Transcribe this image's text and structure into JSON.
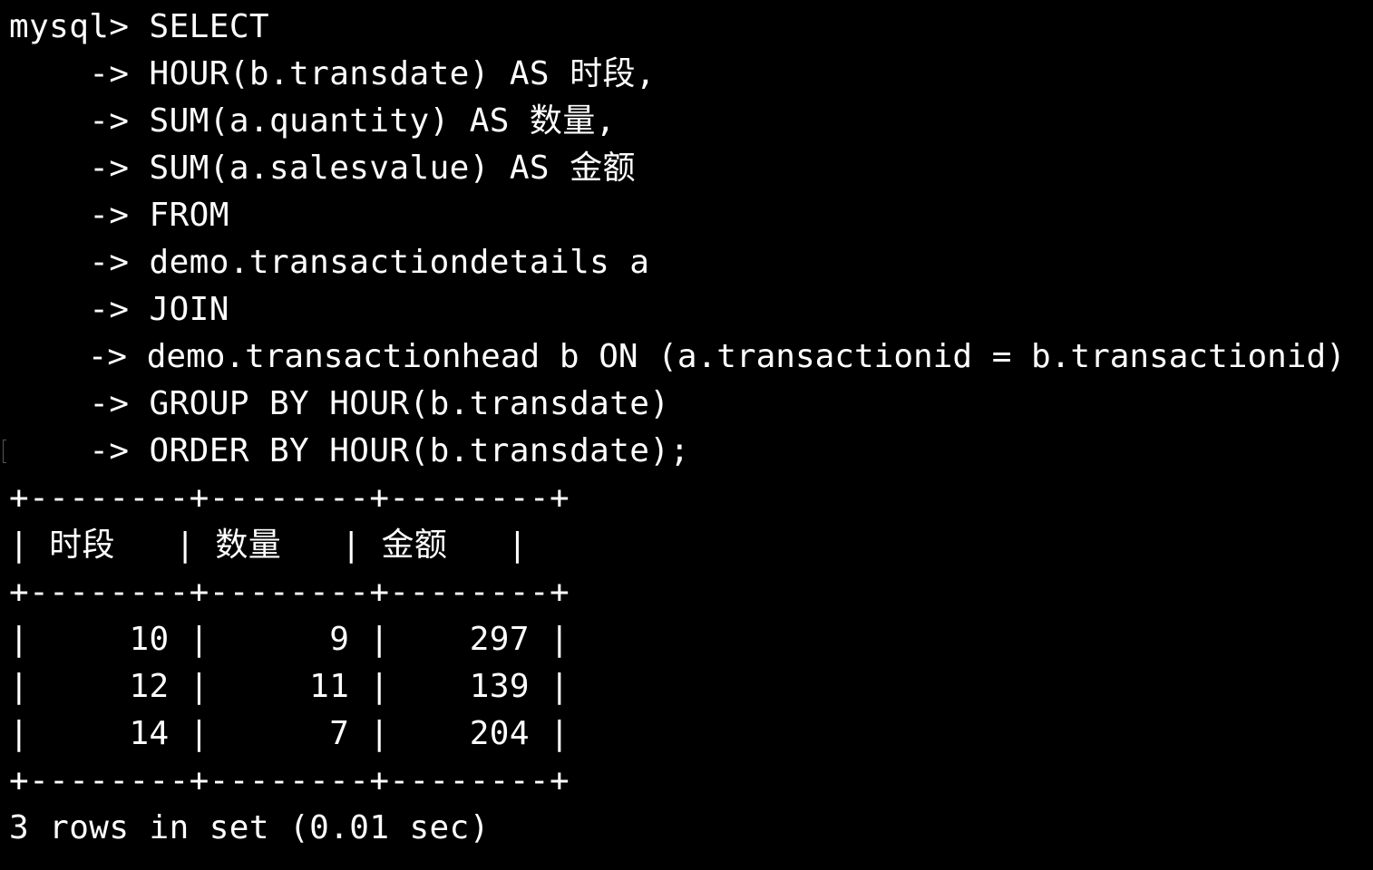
{
  "terminal": {
    "prompt": "mysql> ",
    "continuation": "    -> ",
    "query_lines": [
      "SELECT",
      "HOUR(b.transdate) AS 时段,",
      "SUM(a.quantity) AS 数量,",
      "SUM(a.salesvalue) AS 金额",
      "FROM",
      "demo.transactiondetails a",
      "JOIN",
      "demo.transactionhead b ON (a.transactionid = b.transactionid)",
      "GROUP BY HOUR(b.transdate)",
      "ORDER BY HOUR(b.transdate);"
    ],
    "result_table": {
      "border": "+--------+--------+--------+",
      "headers": [
        "时段",
        "数量",
        "金额"
      ],
      "rows": [
        [
          "10",
          "9",
          "297"
        ],
        [
          "12",
          "11",
          "139"
        ],
        [
          "14",
          "7",
          "204"
        ]
      ]
    },
    "status": "3 rows in set (0.01 sec)"
  },
  "colors": {
    "background": "#000000",
    "text": "#ffffff"
  }
}
